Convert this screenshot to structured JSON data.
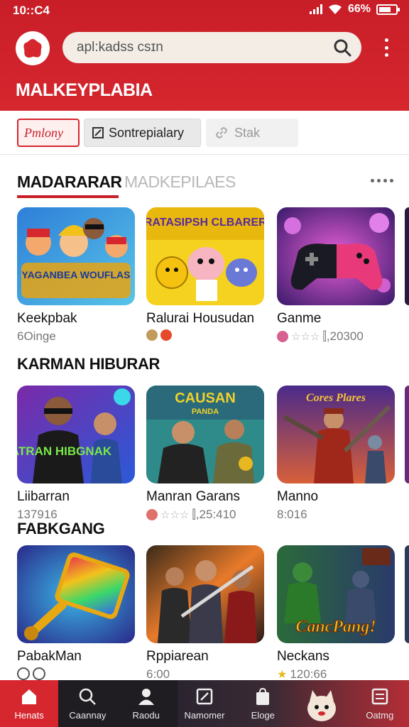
{
  "status_bar": {
    "time": "10::C4",
    "battery": "66%"
  },
  "header": {
    "search_placeholder": "apl:kadss csɪn",
    "brand": "MALKEYPLABIA"
  },
  "chips": [
    {
      "label": "Pmlony",
      "icon": "none"
    },
    {
      "label": "Sontrepialary",
      "icon": "edit-square-icon"
    },
    {
      "label": "Stak",
      "icon": "link-icon"
    }
  ],
  "tabs": {
    "active": "MADARARAR",
    "inactive": "MADKEPILAES"
  },
  "sections": [
    {
      "title": "",
      "cards": [
        {
          "title": "Keekpbak",
          "meta": "6Oinge",
          "rating_icons": ""
        },
        {
          "title": "Ralurai Housudan",
          "meta": "",
          "rating_icons": "emoji"
        },
        {
          "title": "Ganme",
          "meta": "",
          "rating_text": "⫿,20300"
        }
      ]
    },
    {
      "title": "KARMAN HIBURAR",
      "cards": [
        {
          "title": "Liibarran",
          "meta": "137916"
        },
        {
          "title": "Manran Garans",
          "rating_text": "⫿,25:410"
        },
        {
          "title": "Manno",
          "meta": "8:016"
        }
      ]
    },
    {
      "title": "FABKGANG",
      "cards": [
        {
          "title": "PabakMan",
          "meta": ""
        },
        {
          "title": "Rppiarean",
          "meta": "6:00"
        },
        {
          "title": "Neckans",
          "rating_text": "120:66"
        }
      ]
    }
  ],
  "thumb_text": {
    "t1": "YAGANBEA WOUFLAS",
    "t2": "VRATASIPSH CLBARERY",
    "t4": "SIATRAN HIBGNAK",
    "t5": "CAUSAN",
    "t5b": "PANDA",
    "t6": "Cores Plares",
    "t9": "CancPang!"
  },
  "nav": [
    {
      "label": "Henats",
      "icon": "home-icon",
      "active": true
    },
    {
      "label": "Caannay",
      "icon": "search-icon"
    },
    {
      "label": "Raodu",
      "icon": "person-icon"
    },
    {
      "label": "Namomer",
      "icon": "edit-icon"
    },
    {
      "label": "Eloge",
      "icon": "bag-icon"
    },
    {
      "label": "",
      "icon": "mascot-icon"
    },
    {
      "label": "Oatmg",
      "icon": "list-icon"
    }
  ],
  "colors": {
    "brand_red": "#d6262e",
    "nav_bg": "#1f1d22"
  }
}
